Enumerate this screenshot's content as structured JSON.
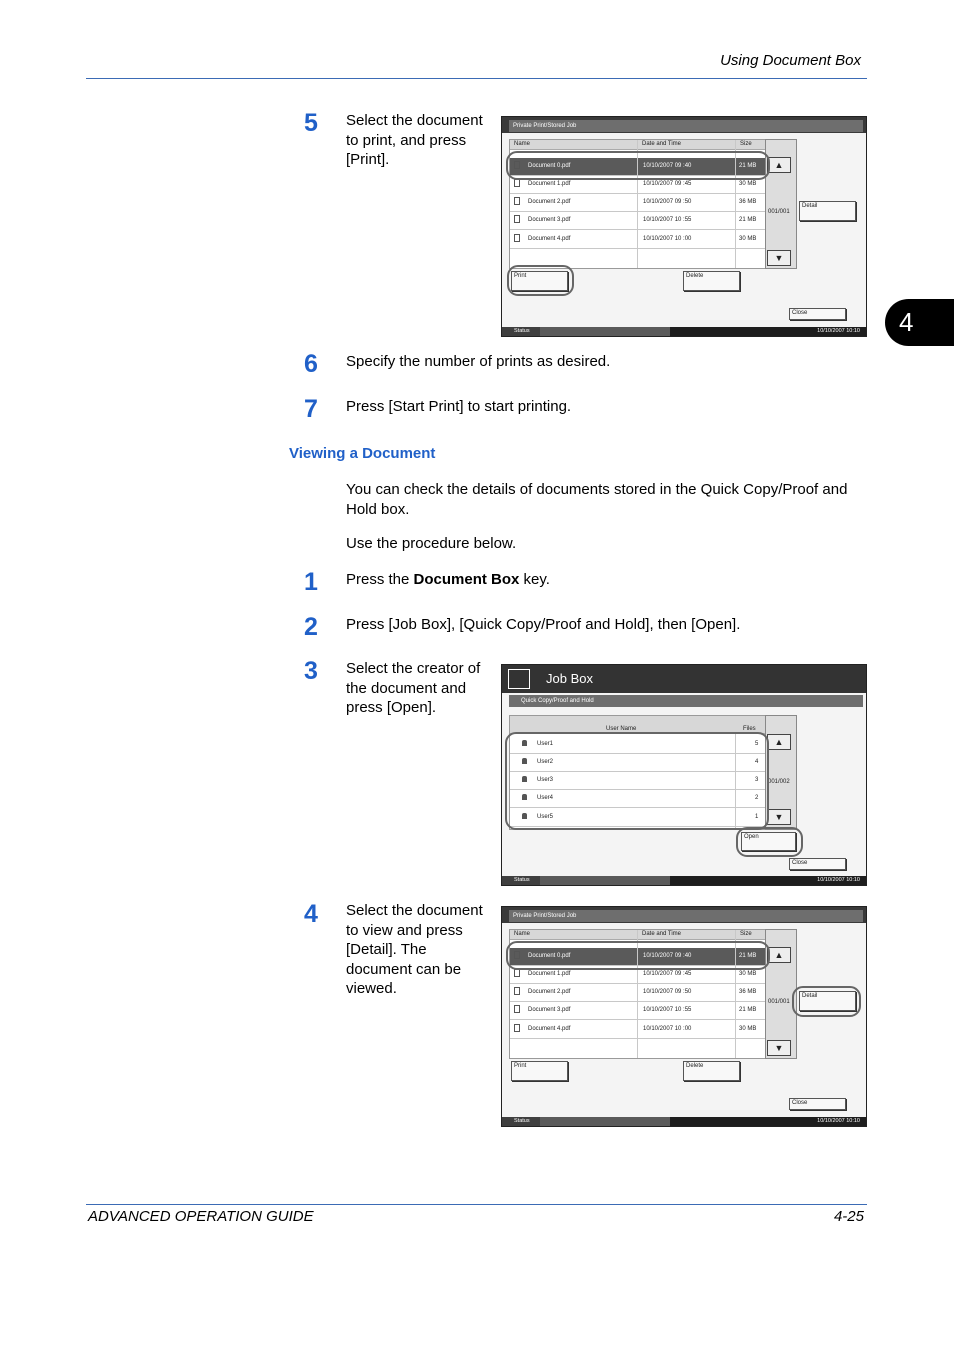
{
  "header": {
    "title": "Using Document Box"
  },
  "chapter_tab": "4",
  "steps_print": [
    {
      "num": "5",
      "text": "Select the document to print, and press [Print]."
    },
    {
      "num": "6",
      "text": "Specify the number of prints as desired."
    },
    {
      "num": "7",
      "text": "Press [Start Print] to start printing."
    }
  ],
  "section_title": "Viewing a Document",
  "intro": [
    "You can check the details of documents stored in the Quick Copy/Proof and Hold box.",
    "Use the procedure below."
  ],
  "steps_view": [
    {
      "num": "1",
      "text_pre": "Press the ",
      "text_bold": "Document Box",
      "text_post": " key."
    },
    {
      "num": "2",
      "text": "Press [Job Box], [Quick Copy/Proof and Hold], then [Open]."
    },
    {
      "num": "3",
      "text": "Select the creator of the document and press [Open]."
    },
    {
      "num": "4",
      "text": "Select the document to view and press [Detail]. The document can be viewed."
    }
  ],
  "doc_screen": {
    "title_bar": "Private Print/Stored Job",
    "columns": [
      "Name",
      "Date and Time",
      "Size"
    ],
    "rows": [
      {
        "name": "Document 0.pdf",
        "date": "10/10/2007 09 :40",
        "size": "21 MB"
      },
      {
        "name": "Document 1.pdf",
        "date": "10/10/2007 09 :45",
        "size": "30 MB"
      },
      {
        "name": "Document 2.pdf",
        "date": "10/10/2007 09 :50",
        "size": "36 MB"
      },
      {
        "name": "Document 3.pdf",
        "date": "10/10/2007 10 :55",
        "size": "21 MB"
      },
      {
        "name": "Document 4.pdf",
        "date": "10/10/2007 10 :00",
        "size": "30 MB"
      }
    ],
    "page": "001/001",
    "detail": "Detail",
    "print": "Print",
    "delete": "Delete",
    "close": "Close",
    "status": "Status",
    "datetime": "10/10/2007   10:10"
  },
  "jobbox_screen": {
    "title": "Job Box",
    "subtitle": "Quick Copy/Proof and Hold",
    "columns": [
      "User Name",
      "Files"
    ],
    "rows": [
      {
        "user": "User1",
        "files": "5"
      },
      {
        "user": "User2",
        "files": "4"
      },
      {
        "user": "User3",
        "files": "3"
      },
      {
        "user": "User4",
        "files": "2"
      },
      {
        "user": "User5",
        "files": "1"
      }
    ],
    "page": "001/002",
    "open": "Open",
    "close": "Close",
    "status": "Status",
    "datetime": "10/10/2007   10:10"
  },
  "footer": {
    "left": "ADVANCED OPERATION GUIDE",
    "right": "4-25"
  },
  "colors": {
    "accent": "#2060c8",
    "rule": "#3b6bb5"
  }
}
